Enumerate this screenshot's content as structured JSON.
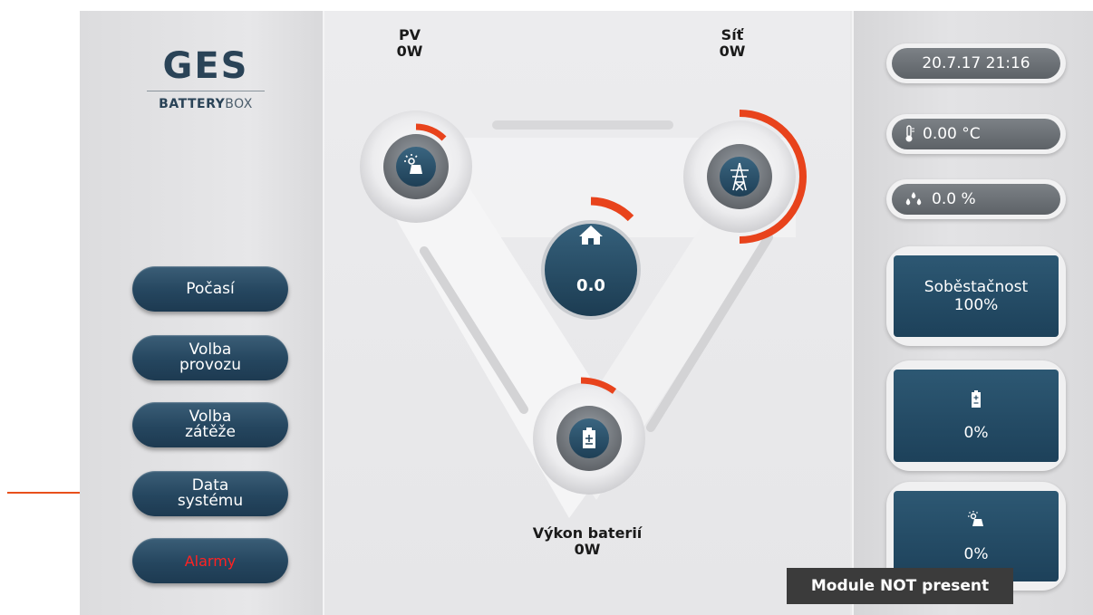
{
  "logo": {
    "mark": "GES",
    "brand_bold": "BATTERY",
    "brand_thin": "BOX"
  },
  "menu": {
    "weather": "Počasí",
    "operation_line1": "Volba",
    "operation_line2": "provozu",
    "load_line1": "Volba",
    "load_line2": "zátěže",
    "data_line1": "Data",
    "data_line2": "systému",
    "alarms": "Alarmy"
  },
  "flow": {
    "pv_label": "PV",
    "pv_value": "0W",
    "grid_label": "Síť",
    "grid_value": "0W",
    "home_value": "0.0",
    "battery_label": "Výkon baterií",
    "battery_value": "0W"
  },
  "status": {
    "datetime": "20.7.17 21:16",
    "temperature": "0.00 °C",
    "humidity": "0.0 %",
    "self_sufficiency_label": "Soběstačnost",
    "self_sufficiency_value": "100%",
    "battery_percent": "0%",
    "solar_percent": "0%",
    "module_message": "Module NOT present"
  },
  "colors": {
    "accent": "#e8431c",
    "tile": "#244a63",
    "button": "#2a4b63",
    "alarm_text": "#ff2222",
    "arrow": "#e8501c"
  },
  "icons": [
    "solar-panel-icon",
    "power-pylon-icon",
    "house-icon",
    "battery-icon",
    "thermometer-icon",
    "droplets-icon"
  ]
}
